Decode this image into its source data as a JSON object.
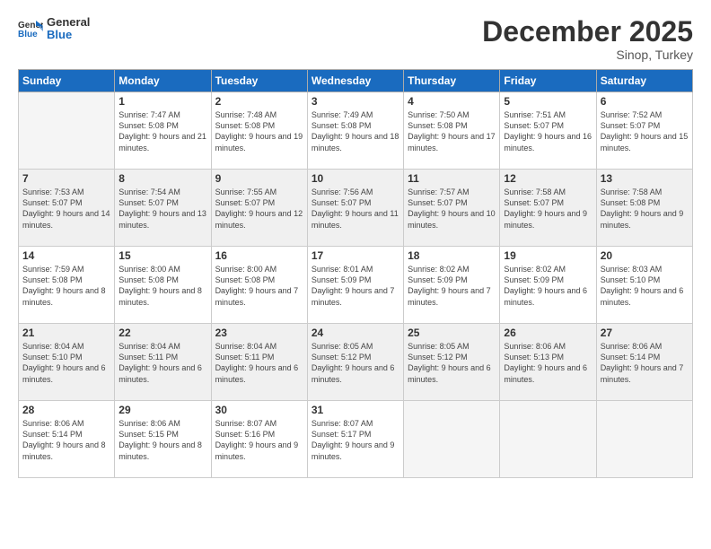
{
  "logo": {
    "line1": "General",
    "line2": "Blue"
  },
  "title": "December 2025",
  "subtitle": "Sinop, Turkey",
  "days_header": [
    "Sunday",
    "Monday",
    "Tuesday",
    "Wednesday",
    "Thursday",
    "Friday",
    "Saturday"
  ],
  "weeks": [
    [
      {
        "day": "",
        "empty": true
      },
      {
        "day": "1",
        "sunrise": "7:47 AM",
        "sunset": "5:08 PM",
        "daylight": "9 hours and 21 minutes."
      },
      {
        "day": "2",
        "sunrise": "7:48 AM",
        "sunset": "5:08 PM",
        "daylight": "9 hours and 19 minutes."
      },
      {
        "day": "3",
        "sunrise": "7:49 AM",
        "sunset": "5:08 PM",
        "daylight": "9 hours and 18 minutes."
      },
      {
        "day": "4",
        "sunrise": "7:50 AM",
        "sunset": "5:08 PM",
        "daylight": "9 hours and 17 minutes."
      },
      {
        "day": "5",
        "sunrise": "7:51 AM",
        "sunset": "5:07 PM",
        "daylight": "9 hours and 16 minutes."
      },
      {
        "day": "6",
        "sunrise": "7:52 AM",
        "sunset": "5:07 PM",
        "daylight": "9 hours and 15 minutes."
      }
    ],
    [
      {
        "day": "7",
        "sunrise": "7:53 AM",
        "sunset": "5:07 PM",
        "daylight": "9 hours and 14 minutes."
      },
      {
        "day": "8",
        "sunrise": "7:54 AM",
        "sunset": "5:07 PM",
        "daylight": "9 hours and 13 minutes."
      },
      {
        "day": "9",
        "sunrise": "7:55 AM",
        "sunset": "5:07 PM",
        "daylight": "9 hours and 12 minutes."
      },
      {
        "day": "10",
        "sunrise": "7:56 AM",
        "sunset": "5:07 PM",
        "daylight": "9 hours and 11 minutes."
      },
      {
        "day": "11",
        "sunrise": "7:57 AM",
        "sunset": "5:07 PM",
        "daylight": "9 hours and 10 minutes."
      },
      {
        "day": "12",
        "sunrise": "7:58 AM",
        "sunset": "5:07 PM",
        "daylight": "9 hours and 9 minutes."
      },
      {
        "day": "13",
        "sunrise": "7:58 AM",
        "sunset": "5:08 PM",
        "daylight": "9 hours and 9 minutes."
      }
    ],
    [
      {
        "day": "14",
        "sunrise": "7:59 AM",
        "sunset": "5:08 PM",
        "daylight": "9 hours and 8 minutes."
      },
      {
        "day": "15",
        "sunrise": "8:00 AM",
        "sunset": "5:08 PM",
        "daylight": "9 hours and 8 minutes."
      },
      {
        "day": "16",
        "sunrise": "8:00 AM",
        "sunset": "5:08 PM",
        "daylight": "9 hours and 7 minutes."
      },
      {
        "day": "17",
        "sunrise": "8:01 AM",
        "sunset": "5:09 PM",
        "daylight": "9 hours and 7 minutes."
      },
      {
        "day": "18",
        "sunrise": "8:02 AM",
        "sunset": "5:09 PM",
        "daylight": "9 hours and 7 minutes."
      },
      {
        "day": "19",
        "sunrise": "8:02 AM",
        "sunset": "5:09 PM",
        "daylight": "9 hours and 6 minutes."
      },
      {
        "day": "20",
        "sunrise": "8:03 AM",
        "sunset": "5:10 PM",
        "daylight": "9 hours and 6 minutes."
      }
    ],
    [
      {
        "day": "21",
        "sunrise": "8:04 AM",
        "sunset": "5:10 PM",
        "daylight": "9 hours and 6 minutes."
      },
      {
        "day": "22",
        "sunrise": "8:04 AM",
        "sunset": "5:11 PM",
        "daylight": "9 hours and 6 minutes."
      },
      {
        "day": "23",
        "sunrise": "8:04 AM",
        "sunset": "5:11 PM",
        "daylight": "9 hours and 6 minutes."
      },
      {
        "day": "24",
        "sunrise": "8:05 AM",
        "sunset": "5:12 PM",
        "daylight": "9 hours and 6 minutes."
      },
      {
        "day": "25",
        "sunrise": "8:05 AM",
        "sunset": "5:12 PM",
        "daylight": "9 hours and 6 minutes."
      },
      {
        "day": "26",
        "sunrise": "8:06 AM",
        "sunset": "5:13 PM",
        "daylight": "9 hours and 6 minutes."
      },
      {
        "day": "27",
        "sunrise": "8:06 AM",
        "sunset": "5:14 PM",
        "daylight": "9 hours and 7 minutes."
      }
    ],
    [
      {
        "day": "28",
        "sunrise": "8:06 AM",
        "sunset": "5:14 PM",
        "daylight": "9 hours and 8 minutes."
      },
      {
        "day": "29",
        "sunrise": "8:06 AM",
        "sunset": "5:15 PM",
        "daylight": "9 hours and 8 minutes."
      },
      {
        "day": "30",
        "sunrise": "8:07 AM",
        "sunset": "5:16 PM",
        "daylight": "9 hours and 9 minutes."
      },
      {
        "day": "31",
        "sunrise": "8:07 AM",
        "sunset": "5:17 PM",
        "daylight": "9 hours and 9 minutes."
      },
      {
        "day": "",
        "empty": true
      },
      {
        "day": "",
        "empty": true
      },
      {
        "day": "",
        "empty": true
      }
    ]
  ]
}
